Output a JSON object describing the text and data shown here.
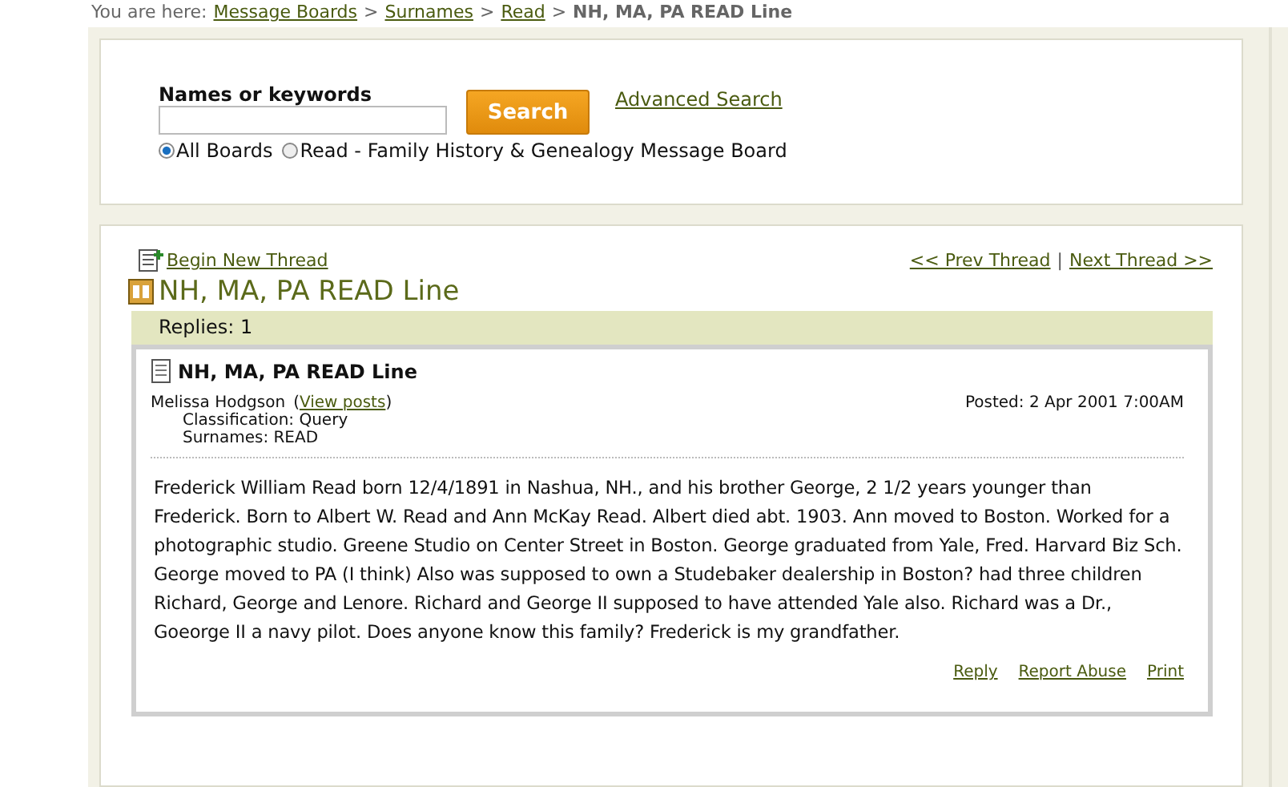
{
  "breadcrumb": {
    "label": "You are here:",
    "links": [
      "Message Boards",
      "Surnames",
      "Read"
    ],
    "current": "NH, MA, PA READ Line",
    "separator": ">"
  },
  "search": {
    "label": "Names or keywords",
    "button": "Search",
    "advanced": "Advanced Search",
    "scopes": [
      {
        "label": "All Boards",
        "selected": true
      },
      {
        "label": "Read - Family History & Genealogy Message Board",
        "selected": false
      }
    ]
  },
  "thread": {
    "begin": "Begin New Thread",
    "prev": "<< Prev Thread",
    "next": "Next Thread >>",
    "nav_separator": "|",
    "title": "NH, MA, PA READ Line",
    "replies": "Replies: 1",
    "post": {
      "title": "NH, MA, PA READ Line",
      "author": "Melissa Hodgson",
      "view_posts": "View posts",
      "view_posts_open": "(",
      "view_posts_close": ")",
      "posted": "Posted: 2 Apr 2001 7:00AM",
      "classification": "Classification: Query",
      "surnames": "Surnames: READ",
      "body": "Frederick William Read born 12/4/1891 in Nashua, NH., and his brother George, 2 1/2 years younger than Frederick. Born to Albert W. Read and Ann McKay Read. Albert died abt. 1903. Ann moved to Boston. Worked for a photographic studio. Greene Studio on Center Street in Boston. George graduated from Yale, Fred. Harvard Biz Sch. George moved to PA (I think) Also was supposed to own a Studebaker dealership in Boston? had three children Richard, George and Lenore. Richard and George II supposed to have attended Yale also. Richard was a Dr., Goeorge II a navy pilot. Does anyone know this family? Frederick is my grandfather.",
      "actions": [
        "Reply",
        "Report Abuse",
        "Print"
      ]
    }
  }
}
